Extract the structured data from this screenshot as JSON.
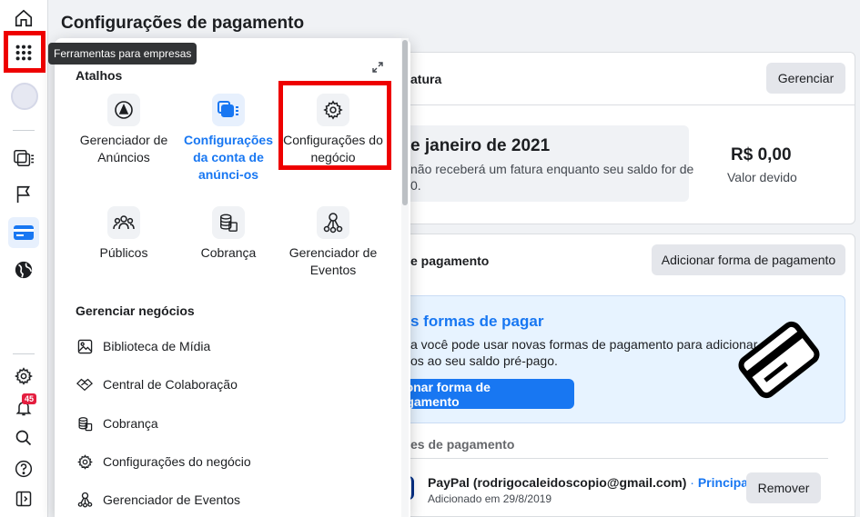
{
  "page": {
    "title": "Configurações de pagamento"
  },
  "tooltip": {
    "text": "Ferramentas para empresas"
  },
  "rail": {
    "notifications_badge": "45"
  },
  "billing": {
    "title_partial": "atura",
    "manage_button": "Gerenciar",
    "date_partial": "e janeiro de 2021",
    "note_line1": "não receberá um fatura enquanto seu saldo for de",
    "note_line2": "0.",
    "amount": "R$ 0,00",
    "amount_label": "Valor devido"
  },
  "payment_methods": {
    "title_partial": "e pagamento",
    "add_button": "Adicionar forma de pagamento",
    "promo_title_partial": "s formas de pagar",
    "promo_line1": "a você pode usar novas formas de pagamento para adicionar",
    "promo_line2": "os ao seu saldo pré-pago.",
    "promo_button_partial": "icionar forma de pagamento",
    "list_header_partial": "es de pagamento",
    "paypal_name": "PayPal (rodrigocaleidoscopio@gmail.com)",
    "separator": "·",
    "primary_label": "Principal",
    "paypal_added": "Adicionado em 29/8/2019",
    "remove_button": "Remover"
  },
  "menu": {
    "shortcuts_header": "Atalhos",
    "shortcuts": [
      {
        "label": "Gerenciador de Anúncios",
        "icon": "ads-manager-icon"
      },
      {
        "label": "Configurações da conta de anúnci-os",
        "icon": "ad-account-settings-icon"
      },
      {
        "label": "Configurações do negócio",
        "icon": "gear-icon"
      },
      {
        "label": "Públicos",
        "icon": "audiences-icon"
      },
      {
        "label": "Cobrança",
        "icon": "billing-icon"
      },
      {
        "label": "Gerenciador de Eventos",
        "icon": "events-manager-icon"
      }
    ],
    "manage_header": "Gerenciar negócios",
    "manage_items": [
      {
        "label": "Biblioteca de Mídia",
        "icon": "media-library-icon"
      },
      {
        "label": "Central de Colaboração",
        "icon": "collaboration-icon"
      },
      {
        "label": "Cobrança",
        "icon": "billing-icon"
      },
      {
        "label": "Configurações do negócio",
        "icon": "gear-icon"
      },
      {
        "label": "Gerenciador de Eventos",
        "icon": "events-manager-icon"
      }
    ]
  },
  "colors": {
    "accent": "#1877f2",
    "highlight": "#ee0000"
  }
}
